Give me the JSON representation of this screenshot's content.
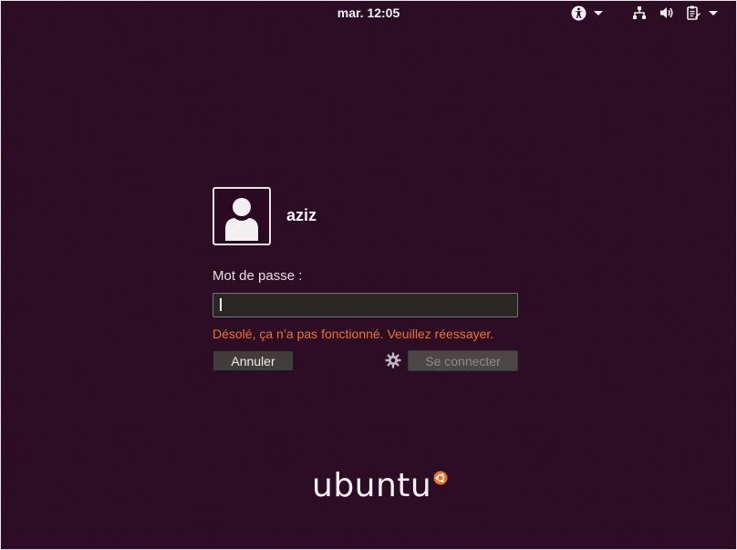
{
  "topbar": {
    "clock": "mar. 12:05",
    "icons": [
      "accessibility-icon",
      "network-icon",
      "volume-icon",
      "power-menu-icon"
    ]
  },
  "login": {
    "username": "aziz",
    "password_label": "Mot de passe :",
    "password_value": "",
    "error_message": "Désolé, ça n’a pas fonctionné. Veuillez réessayer.",
    "cancel_label": "Annuler",
    "login_label": "Se connecter",
    "session_icon": "gear-icon"
  },
  "branding": {
    "logo_text": "ubuntu"
  },
  "colors": {
    "background": "#2c0c25",
    "error": "#f0702a",
    "text": "#f4f1f4"
  }
}
